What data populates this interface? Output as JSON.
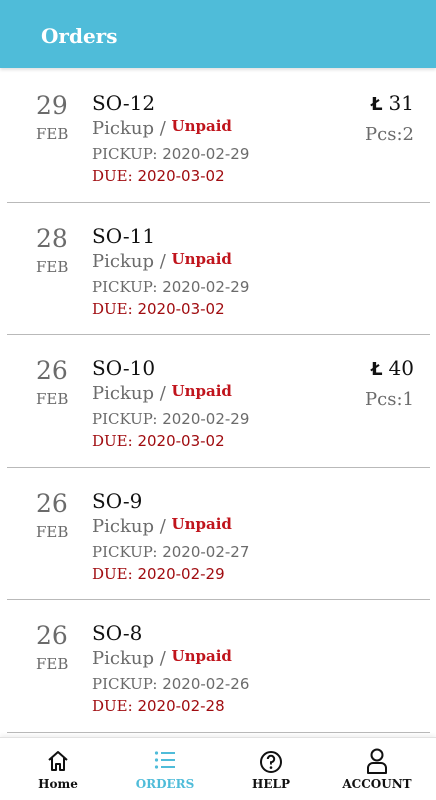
{
  "header": {
    "title": "Orders"
  },
  "orders": [
    {
      "day": "29",
      "month": "FEB",
      "id": "SO-12",
      "type": "Pickup",
      "separator": "/",
      "status": "Unpaid",
      "pickup_label": "PICKUP:",
      "pickup_date": "2020-02-29",
      "due_label": "DUE:",
      "due_date": "2020-03-02",
      "currency": "Ł",
      "amount": "31",
      "pcs": "Pcs:2"
    },
    {
      "day": "28",
      "month": "FEB",
      "id": "SO-11",
      "type": "Pickup",
      "separator": "/",
      "status": "Unpaid",
      "pickup_label": "PICKUP:",
      "pickup_date": "2020-02-29",
      "due_label": "DUE:",
      "due_date": "2020-03-02",
      "currency": "",
      "amount": "",
      "pcs": ""
    },
    {
      "day": "26",
      "month": "FEB",
      "id": "SO-10",
      "type": "Pickup",
      "separator": "/",
      "status": "Unpaid",
      "pickup_label": "PICKUP:",
      "pickup_date": "2020-02-29",
      "due_label": "DUE:",
      "due_date": "2020-03-02",
      "currency": "Ł",
      "amount": "40",
      "pcs": "Pcs:1"
    },
    {
      "day": "26",
      "month": "FEB",
      "id": "SO-9",
      "type": "Pickup",
      "separator": "/",
      "status": "Unpaid",
      "pickup_label": "PICKUP:",
      "pickup_date": "2020-02-27",
      "due_label": "DUE:",
      "due_date": "2020-02-29",
      "currency": "",
      "amount": "",
      "pcs": ""
    },
    {
      "day": "26",
      "month": "FEB",
      "id": "SO-8",
      "type": "Pickup",
      "separator": "/",
      "status": "Unpaid",
      "pickup_label": "PICKUP:",
      "pickup_date": "2020-02-26",
      "due_label": "DUE:",
      "due_date": "2020-02-28",
      "currency": "",
      "amount": "",
      "pcs": ""
    }
  ],
  "nav": {
    "home": {
      "label": "Home",
      "icon": "home-icon"
    },
    "orders": {
      "label": "ORDERS",
      "icon": "list-icon",
      "active": true
    },
    "help": {
      "label": "HELP",
      "icon": "help-circle-icon"
    },
    "account": {
      "label": "ACCOUNT",
      "icon": "user-icon"
    }
  },
  "colors": {
    "header_bg": "#4fbcd9",
    "accent": "#4fbcd9",
    "status_unpaid": "#c0141c",
    "due_text": "#a00c10"
  }
}
